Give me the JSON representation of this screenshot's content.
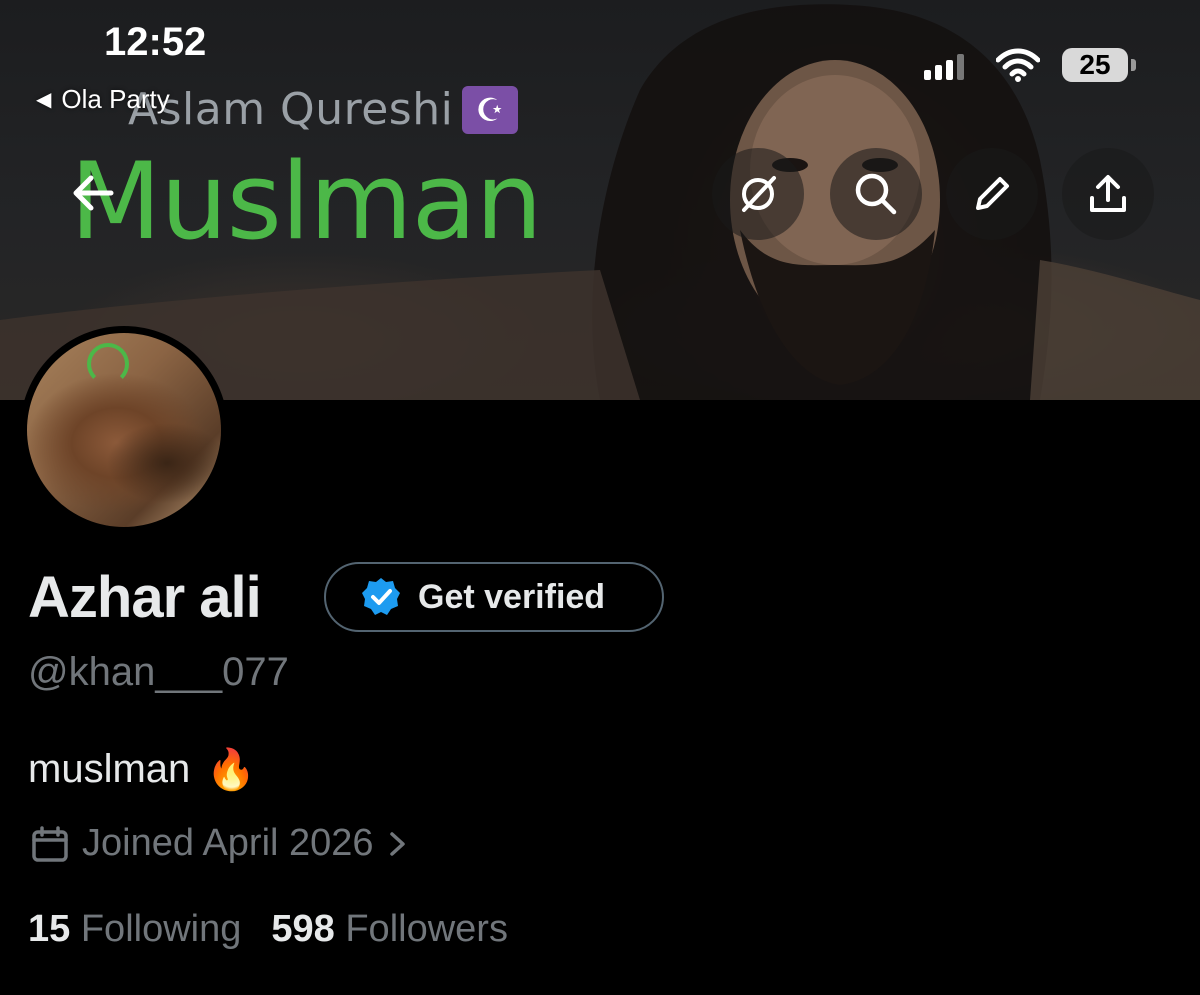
{
  "status_bar": {
    "time": "12:52",
    "back_app": "Ola Party",
    "battery": "25"
  },
  "banner": {
    "subtitle": "Aslam Qureshi",
    "title": "Muslman",
    "title_color": "#4cb848",
    "badge_icon": "crescent-star-icon"
  },
  "actions": {
    "back": "arrow-left-icon",
    "grok": "grok-icon",
    "search": "search-icon",
    "edit": "pencil-icon",
    "share": "share-icon"
  },
  "profile": {
    "display_name": "Azhar ali",
    "get_verified_label": "Get verified",
    "handle": "@khan___077",
    "bio_text": "muslman",
    "bio_emoji": "🔥",
    "joined": "Joined April 2026",
    "following_count": "15",
    "following_label": "Following",
    "followers_count": "598",
    "followers_label": "Followers",
    "verified_color": "#1d9bf0"
  }
}
